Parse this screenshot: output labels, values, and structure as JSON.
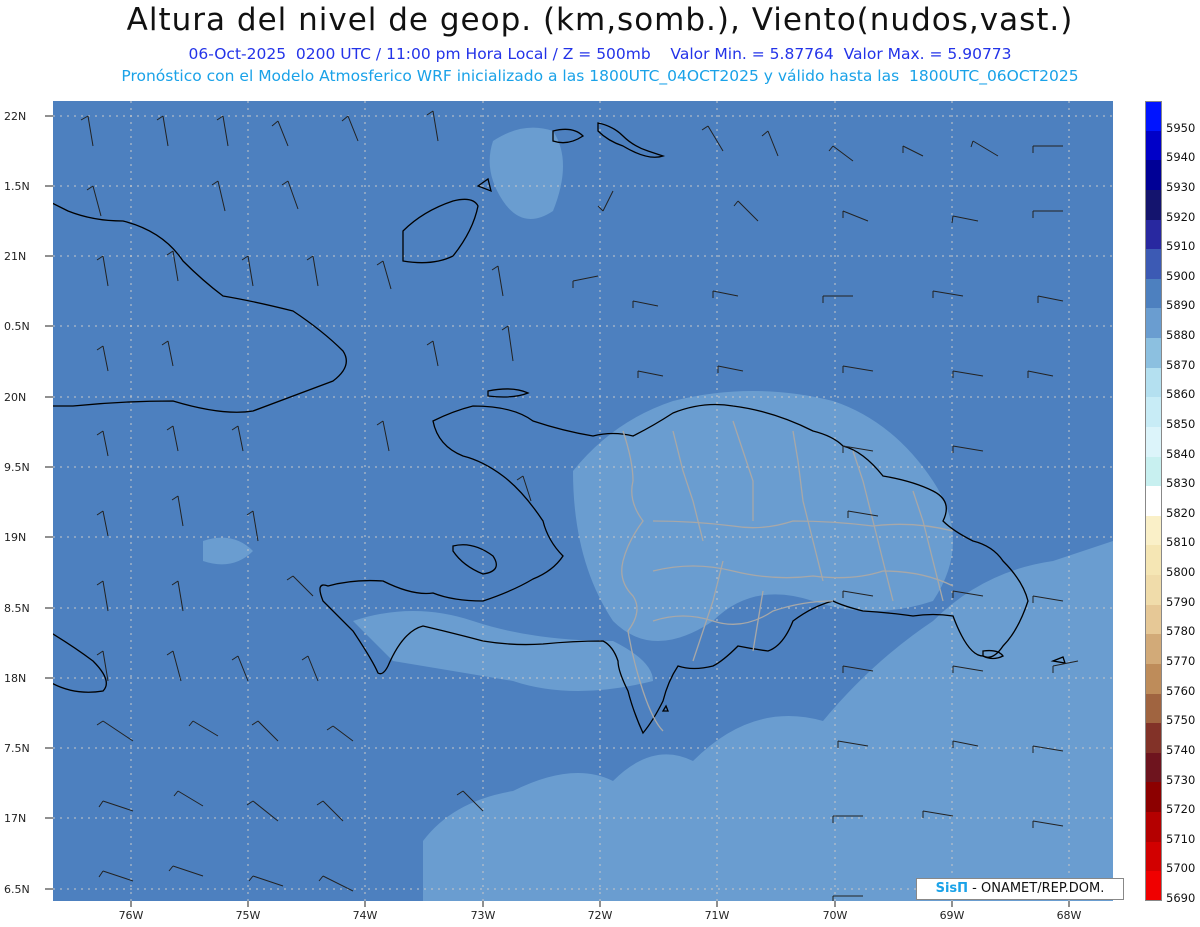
{
  "header": {
    "title": "Altura del nivel de geop. (km,somb.), Viento(nudos,vast.)",
    "line1": "06-Oct-2025  0200 UTC / 11:00 pm Hora Local / Z = 500mb    Valor Min. = 5.87764  Valor Max. = 5.90773",
    "line2": "Pronóstico con el Modelo Atmosferico WRF inicializado a las 1800UTC_04OCT2025 y válido hasta las  1800UTC_06OCT2025"
  },
  "map": {
    "lat_labels": [
      "22N",
      "1.5N",
      "21N",
      "0.5N",
      "20N",
      "9.5N",
      "19N",
      "8.5N",
      "18N",
      "7.5N",
      "17N",
      "6.5N"
    ],
    "lon_labels": [
      "76W",
      "75W",
      "74W",
      "73W",
      "72W",
      "71W",
      "70W",
      "69W",
      "68W"
    ],
    "colors": {
      "ocean_base": "#4d80bf",
      "lighter_field": "#6a9dd0",
      "coast": "#000000",
      "borders": "#a8a8a8",
      "grid": "#c8c8c8"
    }
  },
  "colorbar": {
    "levels": [
      "5950",
      "5940",
      "5930",
      "5920",
      "5910",
      "5900",
      "5890",
      "5880",
      "5870",
      "5860",
      "5850",
      "5840",
      "5830",
      "5820",
      "5810",
      "5800",
      "5790",
      "5780",
      "5770",
      "5760",
      "5750",
      "5740",
      "5730",
      "5720",
      "5710",
      "5700",
      "5690"
    ],
    "colors": [
      "#0014ff",
      "#0000c8",
      "#000096",
      "#14146e",
      "#2828a0",
      "#3c5ab4",
      "#4d80bf",
      "#6a9dd0",
      "#8cc0e0",
      "#b4e0f0",
      "#c8ecf6",
      "#dcf4fa",
      "#c8f0f0",
      "#ffffff",
      "#faf0c8",
      "#f5e6b4",
      "#f0dcaa",
      "#e6c896",
      "#d2aa78",
      "#be8c5a",
      "#a06440",
      "#823228",
      "#6e141e",
      "#8c0000",
      "#b40000",
      "#d20000",
      "#f00000"
    ]
  },
  "credit": {
    "logo": "SisΠ",
    "text": "- ONAMET/REP.DOM."
  }
}
